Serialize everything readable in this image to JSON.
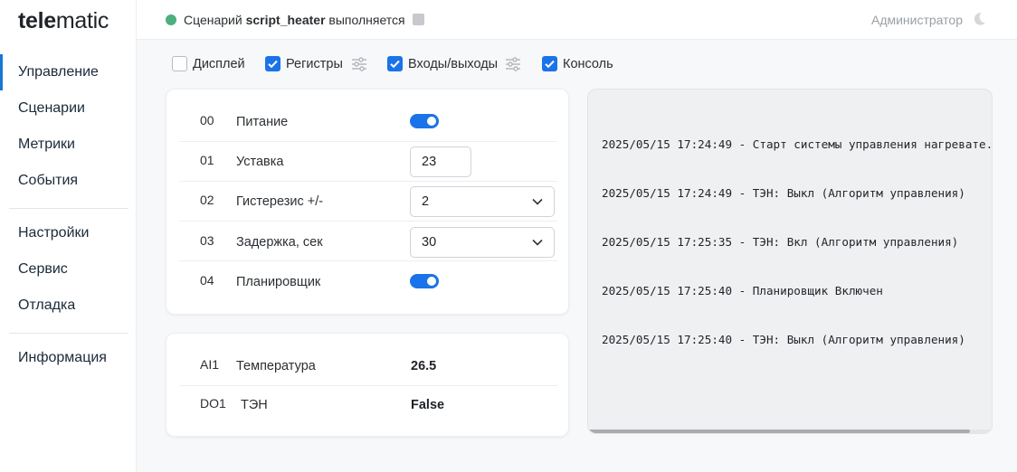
{
  "app": {
    "logo_bold": "tele",
    "logo_rest": "matic"
  },
  "sidebar": {
    "items": [
      {
        "label": "Управление",
        "active": true
      },
      {
        "label": "Сценарии"
      },
      {
        "label": "Метрики"
      },
      {
        "label": "События"
      },
      {
        "label": "Настройки"
      },
      {
        "label": "Сервис"
      },
      {
        "label": "Отладка"
      },
      {
        "label": "Информация"
      }
    ]
  },
  "topbar": {
    "status_prefix": "Сценарий",
    "script_name": "script_heater",
    "status_suffix": "выполняется",
    "status_color": "#4caf7d",
    "user": "Администратор",
    "theme_icon": "moon-icon"
  },
  "filters": [
    {
      "label": "Дисплей",
      "checked": false
    },
    {
      "label": "Регистры",
      "checked": true
    },
    {
      "label": "Входы/выходы",
      "checked": true
    },
    {
      "label": "Консоль",
      "checked": true
    }
  ],
  "registers": [
    {
      "num": "00",
      "name": "Питание",
      "type": "toggle",
      "value": true
    },
    {
      "num": "01",
      "name": "Уставка",
      "type": "input",
      "value": "23"
    },
    {
      "num": "02",
      "name": "Гистерезис +/-",
      "type": "select",
      "value": "2"
    },
    {
      "num": "03",
      "name": "Задержка, сек",
      "type": "select",
      "value": "30"
    },
    {
      "num": "04",
      "name": "Планировщик",
      "type": "toggle",
      "value": true
    }
  ],
  "io": [
    {
      "id": "AI1",
      "name": "Температура",
      "value": "26.5"
    },
    {
      "id": "DO1",
      "name": "ТЭН",
      "value": "False"
    }
  ],
  "console": {
    "lines": [
      "2025/05/15 17:24:49 - Старт системы управления нагревате...",
      "2025/05/15 17:24:49 - ТЭН: Выкл (Алгоритм управления)",
      "2025/05/15 17:25:35 - ТЭН: Вкл (Алгоритм управления)",
      "2025/05/15 17:25:40 - Планировщик Включен",
      "2025/05/15 17:25:40 - ТЭН: Выкл (Алгоритм управления)"
    ]
  },
  "colors": {
    "accent": "#1a73e8",
    "active_nav": "#1976d2"
  }
}
